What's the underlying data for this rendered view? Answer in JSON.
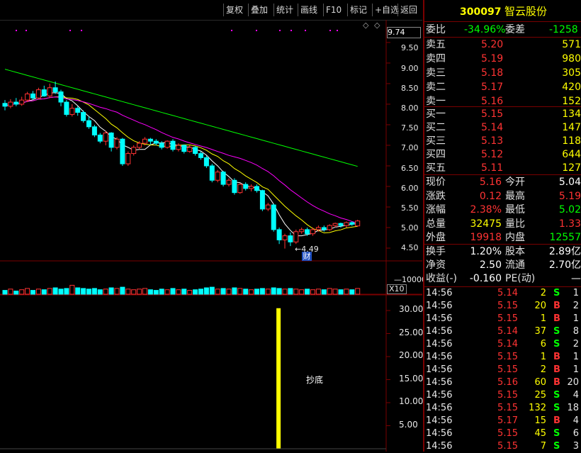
{
  "toolbar": {
    "buttons": [
      "复权",
      "叠加",
      "统计",
      "画线",
      "F10",
      "标记",
      "+自选",
      "返回"
    ]
  },
  "chart": {
    "top_price": "9.74",
    "price_axis": [
      "9.50",
      "9.00",
      "8.50",
      "8.00",
      "7.50",
      "7.00",
      "6.50",
      "6.00",
      "5.50",
      "5.00",
      "4.50"
    ],
    "low_marker": "4.49",
    "finance_tag": "财",
    "volume_axis": "10000",
    "volume_unit": "X10",
    "indicator_axis": [
      "30.00",
      "25.00",
      "20.00",
      "15.00",
      "10.00",
      "5.00"
    ],
    "signal_label": "抄底",
    "colors": {
      "up": "#ff3333",
      "down": "#00ffff",
      "ma_white": "#ffffff",
      "ma_yellow": "#ffff00",
      "ma_magenta": "#ff00ff",
      "ma_green": "#00ff00"
    }
  },
  "stock": {
    "code": "300097",
    "name": "智云股份"
  },
  "order_book": {
    "ratio_label": "委比",
    "ratio_value": "-34.96%",
    "diff_label": "委差",
    "diff_value": "-1258",
    "asks": [
      {
        "label": "卖五",
        "price": "5.20",
        "vol": "571"
      },
      {
        "label": "卖四",
        "price": "5.19",
        "vol": "980"
      },
      {
        "label": "卖三",
        "price": "5.18",
        "vol": "305"
      },
      {
        "label": "卖二",
        "price": "5.17",
        "vol": "420"
      },
      {
        "label": "卖一",
        "price": "5.16",
        "vol": "152"
      }
    ],
    "bids": [
      {
        "label": "买一",
        "price": "5.15",
        "vol": "134"
      },
      {
        "label": "买二",
        "price": "5.14",
        "vol": "147"
      },
      {
        "label": "买三",
        "price": "5.13",
        "vol": "118"
      },
      {
        "label": "买四",
        "price": "5.12",
        "vol": "644"
      },
      {
        "label": "买五",
        "price": "5.11",
        "vol": "127"
      }
    ]
  },
  "quote": [
    {
      "l1": "现价",
      "v1": "5.16",
      "l2": "今开",
      "v2": "5.04"
    },
    {
      "l1": "涨跌",
      "v1": "0.12",
      "l2": "最高",
      "v2": "5.19"
    },
    {
      "l1": "涨幅",
      "v1": "2.38%",
      "l2": "最低",
      "v2": "5.02"
    },
    {
      "l1": "总量",
      "v1": "32475",
      "l2": "量比",
      "v2": "1.33"
    },
    {
      "l1": "外盘",
      "v1": "19918",
      "l2": "内盘",
      "v2": "12557"
    }
  ],
  "fundamentals": [
    {
      "l1": "换手",
      "v1": "1.20%",
      "l2": "股本",
      "v2": "2.89亿"
    },
    {
      "l1": "净资",
      "v1": "2.50",
      "l2": "流通",
      "v2": "2.70亿"
    },
    {
      "l1": "收益(-)",
      "v1": "-0.160",
      "l2": "PE(动)",
      "v2": "—"
    }
  ],
  "ticks": [
    {
      "t": "14:56",
      "p": "5.14",
      "v": "2",
      "d": "S",
      "n": "1"
    },
    {
      "t": "14:56",
      "p": "5.15",
      "v": "20",
      "d": "B",
      "n": "2"
    },
    {
      "t": "14:56",
      "p": "5.15",
      "v": "1",
      "d": "B",
      "n": "1"
    },
    {
      "t": "14:56",
      "p": "5.14",
      "v": "37",
      "d": "S",
      "n": "8"
    },
    {
      "t": "14:56",
      "p": "5.14",
      "v": "6",
      "d": "S",
      "n": "2"
    },
    {
      "t": "14:56",
      "p": "5.15",
      "v": "1",
      "d": "B",
      "n": "1"
    },
    {
      "t": "14:56",
      "p": "5.15",
      "v": "2",
      "d": "B",
      "n": "1"
    },
    {
      "t": "14:56",
      "p": "5.16",
      "v": "60",
      "d": "B",
      "n": "20"
    },
    {
      "t": "14:56",
      "p": "5.15",
      "v": "25",
      "d": "S",
      "n": "4"
    },
    {
      "t": "14:56",
      "p": "5.15",
      "v": "132",
      "d": "S",
      "n": "18"
    },
    {
      "t": "14:56",
      "p": "5.17",
      "v": "15",
      "d": "B",
      "n": "4"
    },
    {
      "t": "14:56",
      "p": "5.15",
      "v": "45",
      "d": "S",
      "n": "6"
    },
    {
      "t": "14:56",
      "p": "5.15",
      "v": "7",
      "d": "S",
      "n": "3"
    }
  ],
  "chart_data": {
    "type": "candlestick",
    "ylim": [
      4.3,
      9.74
    ],
    "candles": [
      {
        "o": 8.02,
        "c": 7.95,
        "h": 8.1,
        "l": 7.85
      },
      {
        "o": 7.95,
        "c": 8.05,
        "h": 8.12,
        "l": 7.9
      },
      {
        "o": 8.05,
        "c": 8.0,
        "h": 8.15,
        "l": 7.95
      },
      {
        "o": 8.0,
        "c": 8.1,
        "h": 8.18,
        "l": 7.96
      },
      {
        "o": 8.1,
        "c": 8.25,
        "h": 8.3,
        "l": 8.05
      },
      {
        "o": 8.25,
        "c": 8.15,
        "h": 8.32,
        "l": 8.1
      },
      {
        "o": 8.15,
        "c": 8.35,
        "h": 8.4,
        "l": 8.12
      },
      {
        "o": 8.35,
        "c": 8.2,
        "h": 8.45,
        "l": 8.18
      },
      {
        "o": 8.2,
        "c": 8.4,
        "h": 8.5,
        "l": 8.15
      },
      {
        "o": 8.4,
        "c": 8.3,
        "h": 8.55,
        "l": 8.25
      },
      {
        "o": 8.3,
        "c": 8.05,
        "h": 8.35,
        "l": 7.95
      },
      {
        "o": 8.05,
        "c": 7.75,
        "h": 8.1,
        "l": 7.7
      },
      {
        "o": 7.75,
        "c": 7.9,
        "h": 8.0,
        "l": 7.7
      },
      {
        "o": 7.9,
        "c": 7.8,
        "h": 7.95,
        "l": 7.72
      },
      {
        "o": 7.8,
        "c": 7.6,
        "h": 7.85,
        "l": 7.55
      },
      {
        "o": 7.6,
        "c": 7.45,
        "h": 7.7,
        "l": 7.4
      },
      {
        "o": 7.45,
        "c": 7.25,
        "h": 7.5,
        "l": 7.2
      },
      {
        "o": 7.25,
        "c": 7.1,
        "h": 7.3,
        "l": 7.05
      },
      {
        "o": 7.1,
        "c": 7.3,
        "h": 7.35,
        "l": 7.0
      },
      {
        "o": 7.3,
        "c": 6.95,
        "h": 7.32,
        "l": 6.85
      },
      {
        "o": 6.95,
        "c": 7.15,
        "h": 7.2,
        "l": 6.9
      },
      {
        "o": 7.15,
        "c": 6.55,
        "h": 7.18,
        "l": 6.5
      },
      {
        "o": 6.55,
        "c": 6.8,
        "h": 6.85,
        "l": 6.5
      },
      {
        "o": 6.8,
        "c": 6.95,
        "h": 7.0,
        "l": 6.75
      },
      {
        "o": 6.95,
        "c": 7.05,
        "h": 7.1,
        "l": 6.9
      },
      {
        "o": 7.05,
        "c": 7.15,
        "h": 7.2,
        "l": 7.0
      },
      {
        "o": 7.15,
        "c": 7.1,
        "h": 7.18,
        "l": 7.02
      },
      {
        "o": 7.1,
        "c": 7.05,
        "h": 7.15,
        "l": 7.0
      },
      {
        "o": 7.05,
        "c": 6.95,
        "h": 7.1,
        "l": 6.9
      },
      {
        "o": 6.95,
        "c": 7.1,
        "h": 7.12,
        "l": 6.92
      },
      {
        "o": 7.1,
        "c": 6.9,
        "h": 7.15,
        "l": 6.85
      },
      {
        "o": 6.9,
        "c": 7.0,
        "h": 7.05,
        "l": 6.85
      },
      {
        "o": 7.0,
        "c": 6.85,
        "h": 7.02,
        "l": 6.8
      },
      {
        "o": 6.85,
        "c": 6.95,
        "h": 7.0,
        "l": 6.82
      },
      {
        "o": 6.95,
        "c": 6.8,
        "h": 6.98,
        "l": 6.75
      },
      {
        "o": 6.8,
        "c": 6.7,
        "h": 6.85,
        "l": 6.65
      },
      {
        "o": 6.7,
        "c": 6.5,
        "h": 6.75,
        "l": 6.45
      },
      {
        "o": 6.5,
        "c": 6.15,
        "h": 6.55,
        "l": 6.1
      },
      {
        "o": 6.15,
        "c": 6.35,
        "h": 6.4,
        "l": 6.1
      },
      {
        "o": 6.35,
        "c": 6.05,
        "h": 6.38,
        "l": 6.0
      },
      {
        "o": 6.05,
        "c": 6.15,
        "h": 6.2,
        "l": 6.0
      },
      {
        "o": 6.15,
        "c": 5.85,
        "h": 6.2,
        "l": 5.8
      },
      {
        "o": 5.85,
        "c": 6.05,
        "h": 6.08,
        "l": 5.82
      },
      {
        "o": 6.05,
        "c": 5.95,
        "h": 6.1,
        "l": 5.9
      },
      {
        "o": 5.95,
        "c": 6.0,
        "h": 6.05,
        "l": 5.88
      },
      {
        "o": 6.0,
        "c": 5.9,
        "h": 6.05,
        "l": 5.85
      },
      {
        "o": 5.9,
        "c": 5.45,
        "h": 5.92,
        "l": 5.4
      },
      {
        "o": 5.45,
        "c": 5.55,
        "h": 5.6,
        "l": 5.4
      },
      {
        "o": 5.55,
        "c": 4.95,
        "h": 5.58,
        "l": 4.9
      },
      {
        "o": 4.95,
        "c": 4.7,
        "h": 5.0,
        "l": 4.6
      },
      {
        "o": 4.7,
        "c": 4.8,
        "h": 4.85,
        "l": 4.49
      },
      {
        "o": 4.8,
        "c": 4.65,
        "h": 4.88,
        "l": 4.55
      },
      {
        "o": 4.65,
        "c": 4.9,
        "h": 4.95,
        "l": 4.6
      },
      {
        "o": 4.9,
        "c": 4.95,
        "h": 5.0,
        "l": 4.85
      },
      {
        "o": 4.95,
        "c": 4.85,
        "h": 5.0,
        "l": 4.8
      },
      {
        "o": 4.85,
        "c": 4.95,
        "h": 5.0,
        "l": 4.8
      },
      {
        "o": 4.95,
        "c": 5.0,
        "h": 5.05,
        "l": 4.9
      },
      {
        "o": 5.0,
        "c": 4.95,
        "h": 5.05,
        "l": 4.9
      },
      {
        "o": 4.95,
        "c": 5.05,
        "h": 5.08,
        "l": 4.92
      },
      {
        "o": 5.05,
        "c": 5.1,
        "h": 5.12,
        "l": 5.0
      },
      {
        "o": 5.1,
        "c": 5.05,
        "h": 5.12,
        "l": 5.0
      },
      {
        "o": 5.05,
        "c": 5.12,
        "h": 5.15,
        "l": 5.0
      },
      {
        "o": 5.12,
        "c": 5.08,
        "h": 5.15,
        "l": 5.04
      },
      {
        "o": 5.04,
        "c": 5.16,
        "h": 5.19,
        "l": 5.02
      }
    ],
    "volumes": [
      0.6,
      0.8,
      0.5,
      0.7,
      0.9,
      0.6,
      0.8,
      0.7,
      0.9,
      1.0,
      0.8,
      0.9,
      1.4,
      1.0,
      0.9,
      0.8,
      0.9,
      0.7,
      0.8,
      1.0,
      0.9,
      1.1,
      0.8,
      0.7,
      0.8,
      0.9,
      0.7,
      0.6,
      0.8,
      0.7,
      0.9,
      0.7,
      0.8,
      0.6,
      0.7,
      0.8,
      1.0,
      1.1,
      0.8,
      0.9,
      0.8,
      1.0,
      0.9,
      0.8,
      0.7,
      0.8,
      0.9,
      0.8,
      1.0,
      0.9,
      0.8,
      0.9,
      0.8,
      0.7,
      0.8,
      0.7,
      0.8,
      0.7,
      0.9,
      0.8,
      0.7,
      0.8,
      0.7,
      0.9
    ],
    "indicator_spike_index": 49,
    "indicator_spike_value": 30.5
  }
}
